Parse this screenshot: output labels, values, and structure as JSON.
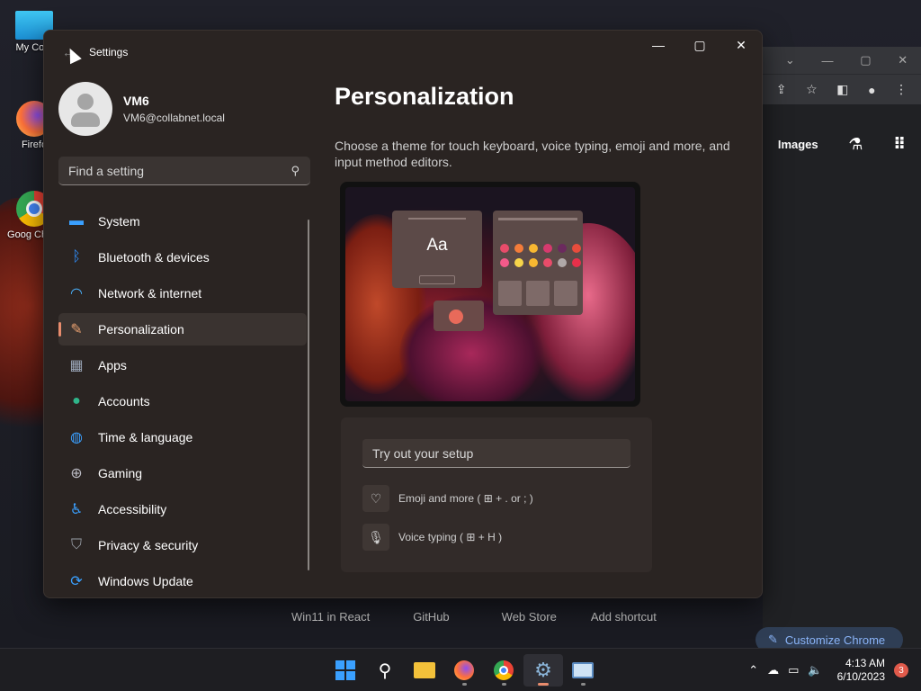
{
  "desktop": {
    "icons": [
      {
        "label": "My Com",
        "icon": "monitor-icon"
      },
      {
        "label": "Firefo",
        "icon": "firefox-icon"
      },
      {
        "label": "Goog Chron",
        "icon": "chrome-icon"
      }
    ]
  },
  "chrome": {
    "nav_label": "Images",
    "links": [
      "Win11 in React",
      "GitHub",
      "Web Store",
      "Add shortcut"
    ],
    "customize_label": "Customize Chrome"
  },
  "settings": {
    "title": "Settings",
    "user": {
      "name": "VM6",
      "email": "VM6@collabnet.local"
    },
    "search_placeholder": "Find a setting",
    "nav": [
      {
        "label": "System",
        "icon": "monitor-icon",
        "color": "#3aa0ff"
      },
      {
        "label": "Bluetooth & devices",
        "icon": "bluetooth-icon",
        "color": "#2e8fff"
      },
      {
        "label": "Network & internet",
        "icon": "wifi-icon",
        "color": "#4ab3ff"
      },
      {
        "label": "Personalization",
        "icon": "brush-icon",
        "color": "#e8a070",
        "active": true
      },
      {
        "label": "Apps",
        "icon": "apps-icon",
        "color": "#9aa6b8"
      },
      {
        "label": "Accounts",
        "icon": "person-icon",
        "color": "#2fb58a"
      },
      {
        "label": "Time & language",
        "icon": "globe-icon",
        "color": "#3aa0ff"
      },
      {
        "label": "Gaming",
        "icon": "gamepad-icon",
        "color": "#b8b8c0"
      },
      {
        "label": "Accessibility",
        "icon": "accessibility-icon",
        "color": "#3aa0ff"
      },
      {
        "label": "Privacy & security",
        "icon": "shield-icon",
        "color": "#9aa0a8"
      },
      {
        "label": "Windows Update",
        "icon": "update-icon",
        "color": "#3aa0ff"
      }
    ],
    "page_title": "Personalization",
    "description": "Choose a theme for touch keyboard, voice typing, emoji and more, and input method editors.",
    "preview_text": "Aa",
    "tryout": {
      "placeholder": "Try out your setup",
      "emoji_label": "Emoji and more ( ⊞ + . or ; )",
      "voice_label": "Voice typing ( ⊞ + H )"
    }
  },
  "taskbar": {
    "time": "4:13 AM",
    "date": "6/10/2023",
    "notifications": "3"
  }
}
